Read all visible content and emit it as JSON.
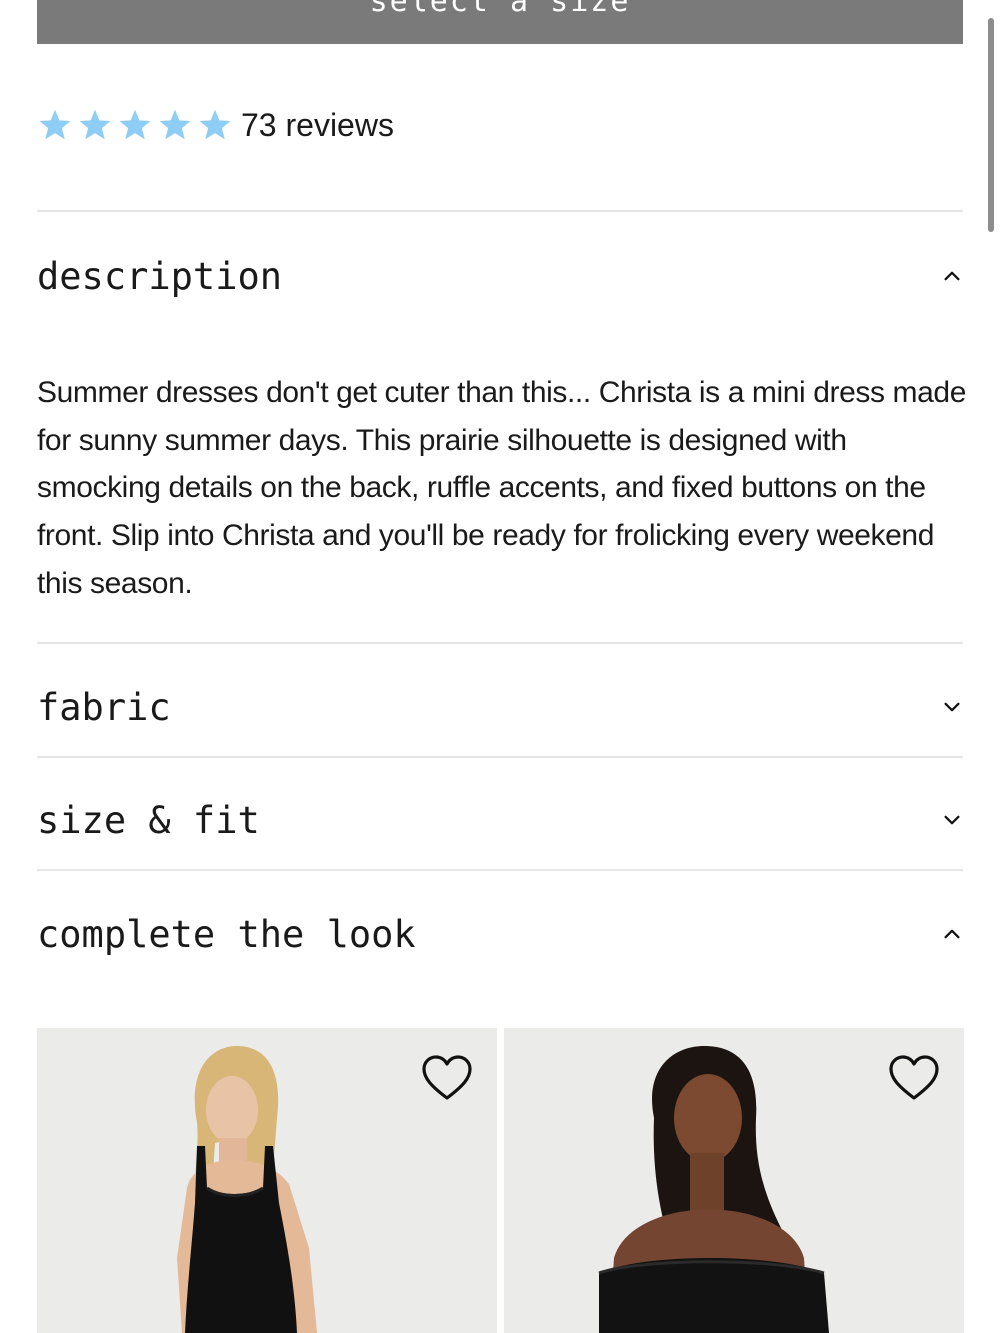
{
  "select_size": {
    "label": "select a size"
  },
  "reviews": {
    "rating": 5,
    "max_rating": 5,
    "text": "73 reviews",
    "star_color": "#8ecdf5"
  },
  "accordion": {
    "description": {
      "title": "description",
      "state": "expanded",
      "body": "Summer dresses don't get cuter than this... Christa is a mini dress made for sunny summer days. This prairie silhouette is designed with smocking details on the back, ruffle accents, and fixed buttons on the front. Slip into Christa and you'll be ready for frolicking every weekend this season."
    },
    "fabric": {
      "title": "fabric",
      "state": "collapsed"
    },
    "size_fit": {
      "title": "size & fit",
      "state": "collapsed"
    },
    "complete_the_look": {
      "title": "complete the look",
      "state": "expanded"
    }
  },
  "products": [
    {
      "image": "model-black-square-neck-dress",
      "icon": "heart-icon"
    },
    {
      "image": "model-black-off-shoulder-top",
      "icon": "heart-icon"
    }
  ],
  "colors": {
    "select_bar": "#7a7a7a",
    "divider": "#e6e6e6",
    "card_background": "#ebebea",
    "text": "#1a1a1a"
  }
}
